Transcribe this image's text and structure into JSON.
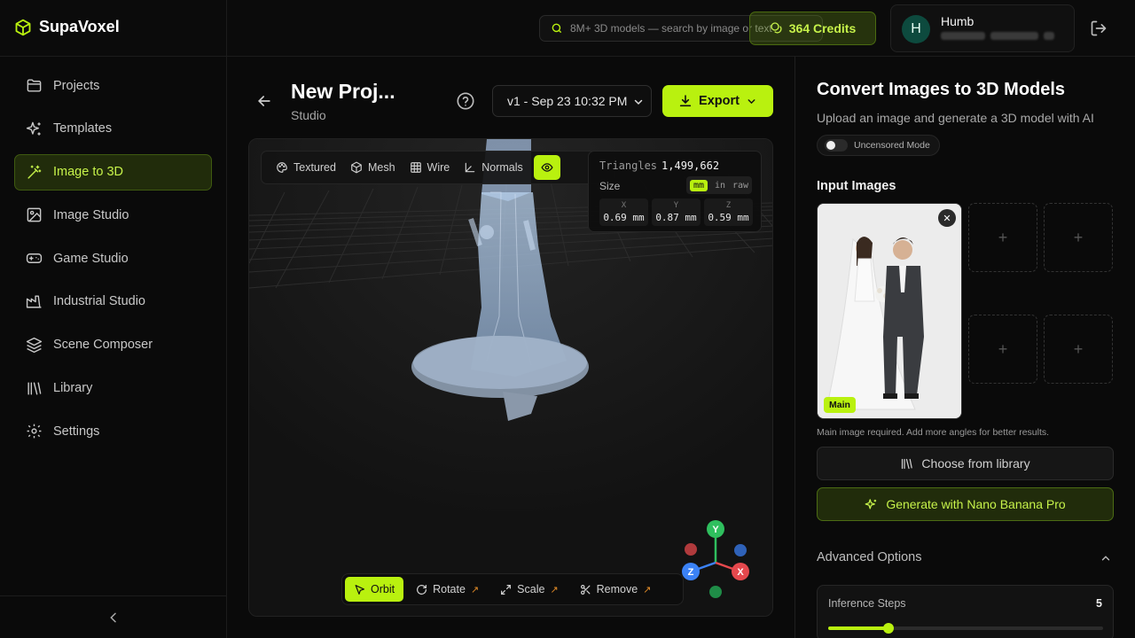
{
  "app": {
    "name": "SupaVoxel"
  },
  "header": {
    "search_placeholder": "8M+ 3D models — search by image or text",
    "credits_label": "364 Credits",
    "user": {
      "initial": "H",
      "name": "Humb"
    }
  },
  "sidebar": {
    "items": [
      {
        "label": "Projects",
        "icon": "folder-icon",
        "active": false
      },
      {
        "label": "Templates",
        "icon": "sparkles-icon",
        "active": false
      },
      {
        "label": "Image to 3D",
        "icon": "magic-wand-icon",
        "active": true
      },
      {
        "label": "Image Studio",
        "icon": "image-icon",
        "active": false
      },
      {
        "label": "Game Studio",
        "icon": "gamepad-icon",
        "active": false
      },
      {
        "label": "Industrial Studio",
        "icon": "factory-icon",
        "active": false
      },
      {
        "label": "Scene Composer",
        "icon": "layers-icon",
        "active": false
      },
      {
        "label": "Library",
        "icon": "library-icon",
        "active": false
      },
      {
        "label": "Settings",
        "icon": "gear-icon",
        "active": false
      }
    ]
  },
  "project": {
    "title": "New Proj...",
    "subtitle": "Studio",
    "version": "v1 - Sep 23 10:32 PM",
    "export_label": "Export"
  },
  "viewport": {
    "modes": [
      "Textured",
      "Mesh",
      "Wire",
      "Normals"
    ],
    "stats": {
      "triangles_label": "Triangles",
      "triangles_value": "1,499,662",
      "size_label": "Size",
      "units": [
        "mm",
        "in",
        "raw"
      ],
      "active_unit": "mm",
      "dims": [
        {
          "axis": "X",
          "value": "0.69 mm"
        },
        {
          "axis": "Y",
          "value": "0.87 mm"
        },
        {
          "axis": "Z",
          "value": "0.59 mm"
        }
      ]
    },
    "tools": [
      "Orbit",
      "Rotate",
      "Scale",
      "Remove"
    ],
    "active_tool": "Orbit",
    "gizmo": {
      "y": "Y",
      "z": "Z",
      "x": "X"
    },
    "colors": {
      "accent": "#b9f10f",
      "x_axis": "#e5484d",
      "y_axis": "#2fbf5e",
      "z_axis": "#3b82f6"
    }
  },
  "panel": {
    "title": "Convert Images to 3D Models",
    "subtitle": "Upload an image and generate a 3D model with AI",
    "uncensored_label": "Uncensored Mode",
    "input_images_label": "Input Images",
    "main_badge": "Main",
    "hint": "Main image required. Add more angles for better results.",
    "library_button": "Choose from library",
    "generate_button": "Generate with Nano Banana Pro",
    "advanced_label": "Advanced Options",
    "inference": {
      "label": "Inference Steps",
      "value": "5",
      "fraction": 0.22
    }
  }
}
